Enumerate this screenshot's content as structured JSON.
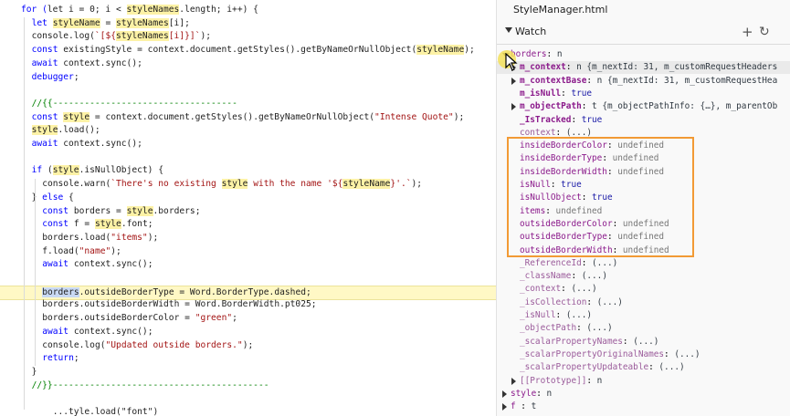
{
  "editor": {
    "lines": [
      {
        "indent": 0,
        "segs": [
          {
            "t": "for (",
            "c": "kw"
          },
          {
            "t": "let i = 0; i < "
          },
          {
            "t": "styleNames",
            "c": "hl"
          },
          {
            "t": ".length; i++) {"
          }
        ]
      },
      {
        "indent": 1,
        "segs": [
          {
            "t": "let ",
            "c": "kw"
          },
          {
            "t": "styleName",
            "c": "hl"
          },
          {
            "t": " = "
          },
          {
            "t": "styleNames",
            "c": "hl"
          },
          {
            "t": "[i];"
          }
        ]
      },
      {
        "indent": 1,
        "segs": [
          {
            "t": "console.log("
          },
          {
            "t": "`[${",
            "c": "str"
          },
          {
            "t": "styleNames",
            "c": "hl"
          },
          {
            "t": "[i]}]`",
            "c": "str"
          },
          {
            "t": ");"
          }
        ]
      },
      {
        "indent": 1,
        "segs": [
          {
            "t": "const ",
            "c": "kw"
          },
          {
            "t": "existingStyle = context.document.getStyles().getByNameOrNullObject("
          },
          {
            "t": "styleName",
            "c": "hl"
          },
          {
            "t": ");"
          }
        ]
      },
      {
        "indent": 1,
        "segs": [
          {
            "t": "await ",
            "c": "kw"
          },
          {
            "t": "context.sync();"
          }
        ]
      },
      {
        "indent": 1,
        "segs": [
          {
            "t": "debugger",
            "c": "kw"
          },
          {
            "t": ";"
          }
        ]
      },
      {
        "indent": 1,
        "segs": []
      },
      {
        "indent": 1,
        "segs": [
          {
            "t": "//{{-----------------------------------",
            "c": "cm"
          }
        ]
      },
      {
        "indent": 1,
        "segs": [
          {
            "t": "const ",
            "c": "kw"
          },
          {
            "t": "style",
            "c": "hl"
          },
          {
            "t": " = context.document.getStyles().getByNameOrNullObject("
          },
          {
            "t": "\"Intense Quote\"",
            "c": "str"
          },
          {
            "t": ");"
          }
        ]
      },
      {
        "indent": 1,
        "segs": [
          {
            "t": "style",
            "c": "hl"
          },
          {
            "t": ".load();"
          }
        ]
      },
      {
        "indent": 1,
        "segs": [
          {
            "t": "await ",
            "c": "kw"
          },
          {
            "t": "context.sync();"
          }
        ]
      },
      {
        "indent": 1,
        "segs": []
      },
      {
        "indent": 1,
        "segs": [
          {
            "t": "if ",
            "c": "kw"
          },
          {
            "t": "("
          },
          {
            "t": "style",
            "c": "hl"
          },
          {
            "t": ".isNullObject) {"
          }
        ]
      },
      {
        "indent": 2,
        "segs": [
          {
            "t": "console.warn("
          },
          {
            "t": "`There's no existing ",
            "c": "str"
          },
          {
            "t": "style",
            "c": "hl"
          },
          {
            "t": " with the name '${",
            "c": "str"
          },
          {
            "t": "styleName",
            "c": "hl"
          },
          {
            "t": "}'.`",
            "c": "str"
          },
          {
            "t": ");"
          }
        ]
      },
      {
        "indent": 1,
        "segs": [
          {
            "t": "} "
          },
          {
            "t": "else ",
            "c": "kw"
          },
          {
            "t": "{"
          }
        ]
      },
      {
        "indent": 2,
        "segs": [
          {
            "t": "const ",
            "c": "kw"
          },
          {
            "t": "borders = "
          },
          {
            "t": "style",
            "c": "hl"
          },
          {
            "t": ".borders;"
          }
        ]
      },
      {
        "indent": 2,
        "segs": [
          {
            "t": "const ",
            "c": "kw"
          },
          {
            "t": "f = "
          },
          {
            "t": "style",
            "c": "hl"
          },
          {
            "t": ".font;"
          }
        ]
      },
      {
        "indent": 2,
        "segs": [
          {
            "t": "borders.load("
          },
          {
            "t": "\"items\"",
            "c": "str"
          },
          {
            "t": ");"
          }
        ]
      },
      {
        "indent": 2,
        "segs": [
          {
            "t": "f.load("
          },
          {
            "t": "\"name\"",
            "c": "str"
          },
          {
            "t": ");"
          }
        ]
      },
      {
        "indent": 2,
        "segs": [
          {
            "t": "await ",
            "c": "kw"
          },
          {
            "t": "context.sync();"
          }
        ]
      },
      {
        "indent": 2,
        "segs": []
      },
      {
        "indent": 2,
        "current": true,
        "segs": [
          {
            "t": "borders",
            "c": "sel"
          },
          {
            "t": ".outsideBorderType = Word.BorderType.dashed;"
          }
        ]
      },
      {
        "indent": 2,
        "segs": [
          {
            "t": "borders.outsideBorderWidth = Word.BorderWidth.pt025;"
          }
        ]
      },
      {
        "indent": 2,
        "segs": [
          {
            "t": "borders.outsideBorderColor = "
          },
          {
            "t": "\"green\"",
            "c": "str"
          },
          {
            "t": ";"
          }
        ]
      },
      {
        "indent": 2,
        "segs": [
          {
            "t": "await ",
            "c": "kw"
          },
          {
            "t": "context.sync();"
          }
        ]
      },
      {
        "indent": 2,
        "segs": [
          {
            "t": "console.log("
          },
          {
            "t": "\"Updated outside borders.\"",
            "c": "str"
          },
          {
            "t": ");"
          }
        ]
      },
      {
        "indent": 2,
        "segs": [
          {
            "t": "return",
            "c": "kw"
          },
          {
            "t": ";"
          }
        ]
      },
      {
        "indent": 1,
        "segs": [
          {
            "t": "}"
          }
        ]
      },
      {
        "indent": 1,
        "segs": [
          {
            "t": "//}}-----------------------------------------",
            "c": "cm"
          }
        ]
      },
      {
        "indent": 1,
        "segs": []
      },
      {
        "indent": 1,
        "segs": [
          {
            "t": "    ...tyle.load(\"font\")"
          }
        ]
      }
    ]
  },
  "debugger": {
    "file_title": "StyleManager.html",
    "watch_label": "Watch",
    "add_icon": "plus-icon",
    "refresh_icon": "refresh-icon",
    "rows": [
      {
        "level": 0,
        "arrow": "down",
        "key": "borders",
        "sep": ": ",
        "val": "n",
        "kcls": "",
        "vcls": ""
      },
      {
        "level": 1,
        "arrow": "right",
        "key": "m_context",
        "sep": ": ",
        "val": "n {m_nextId: 31, m_customRequestHeaders",
        "kcls": "bold",
        "vcls": "",
        "hover": true
      },
      {
        "level": 1,
        "arrow": "right",
        "key": "m_contextBase",
        "sep": ": ",
        "val": "n {m_nextId: 31, m_customRequestHea",
        "kcls": "bold",
        "vcls": ""
      },
      {
        "level": 1,
        "arrow": "",
        "key": "m_isNull",
        "sep": ": ",
        "val": "true",
        "kcls": "bold",
        "vcls": "num"
      },
      {
        "level": 1,
        "arrow": "right",
        "key": "m_objectPath",
        "sep": ": ",
        "val": "t {m_objectPathInfo: {…}, m_parentOb",
        "kcls": "bold",
        "vcls": ""
      },
      {
        "level": 1,
        "arrow": "",
        "key": "_IsTracked",
        "sep": ": ",
        "val": "true",
        "kcls": "bold",
        "vcls": "num"
      },
      {
        "level": 1,
        "arrow": "",
        "key": "context",
        "sep": ": ",
        "val": "(...)",
        "kcls": "dim",
        "vcls": ""
      },
      {
        "level": 1,
        "arrow": "",
        "key": "insideBorderColor",
        "sep": ": ",
        "val": "undefined",
        "kcls": "",
        "vcls": "dim"
      },
      {
        "level": 1,
        "arrow": "",
        "key": "insideBorderType",
        "sep": ": ",
        "val": "undefined",
        "kcls": "",
        "vcls": "dim"
      },
      {
        "level": 1,
        "arrow": "",
        "key": "insideBorderWidth",
        "sep": ": ",
        "val": "undefined",
        "kcls": "",
        "vcls": "dim"
      },
      {
        "level": 1,
        "arrow": "",
        "key": "isNull",
        "sep": ": ",
        "val": "true",
        "kcls": "",
        "vcls": "num"
      },
      {
        "level": 1,
        "arrow": "",
        "key": "isNullObject",
        "sep": ": ",
        "val": "true",
        "kcls": "",
        "vcls": "num"
      },
      {
        "level": 1,
        "arrow": "",
        "key": "items",
        "sep": ": ",
        "val": "undefined",
        "kcls": "",
        "vcls": "dim"
      },
      {
        "level": 1,
        "arrow": "",
        "key": "outsideBorderColor",
        "sep": ": ",
        "val": "undefined",
        "kcls": "",
        "vcls": "dim"
      },
      {
        "level": 1,
        "arrow": "",
        "key": "outsideBorderType",
        "sep": ": ",
        "val": "undefined",
        "kcls": "",
        "vcls": "dim"
      },
      {
        "level": 1,
        "arrow": "",
        "key": "outsideBorderWidth",
        "sep": ": ",
        "val": "undefined",
        "kcls": "",
        "vcls": "dim"
      },
      {
        "level": 1,
        "arrow": "",
        "key": "_ReferenceId",
        "sep": ": ",
        "val": "(...)",
        "kcls": "dim",
        "vcls": ""
      },
      {
        "level": 1,
        "arrow": "",
        "key": "_className",
        "sep": ": ",
        "val": "(...)",
        "kcls": "dim",
        "vcls": ""
      },
      {
        "level": 1,
        "arrow": "",
        "key": "_context",
        "sep": ": ",
        "val": "(...)",
        "kcls": "dim",
        "vcls": ""
      },
      {
        "level": 1,
        "arrow": "",
        "key": "_isCollection",
        "sep": ": ",
        "val": "(...)",
        "kcls": "dim",
        "vcls": ""
      },
      {
        "level": 1,
        "arrow": "",
        "key": "_isNull",
        "sep": ": ",
        "val": "(...)",
        "kcls": "dim",
        "vcls": ""
      },
      {
        "level": 1,
        "arrow": "",
        "key": "_objectPath",
        "sep": ": ",
        "val": "(...)",
        "kcls": "dim",
        "vcls": ""
      },
      {
        "level": 1,
        "arrow": "",
        "key": "_scalarPropertyNames",
        "sep": ": ",
        "val": "(...)",
        "kcls": "dim",
        "vcls": ""
      },
      {
        "level": 1,
        "arrow": "",
        "key": "_scalarPropertyOriginalNames",
        "sep": ": ",
        "val": "(...)",
        "kcls": "dim",
        "vcls": ""
      },
      {
        "level": 1,
        "arrow": "",
        "key": "_scalarPropertyUpdateable",
        "sep": ": ",
        "val": "(...)",
        "kcls": "dim",
        "vcls": ""
      },
      {
        "level": 1,
        "arrow": "right",
        "key": "[[Prototype]]",
        "sep": ": ",
        "val": "n",
        "kcls": "dim",
        "vcls": ""
      },
      {
        "level": 0,
        "arrow": "right",
        "key": "style",
        "sep": ": ",
        "val": "n",
        "kcls": "",
        "vcls": ""
      },
      {
        "level": 0,
        "arrow": "right",
        "key": "f",
        "sep": "  : ",
        "val": "t",
        "kcls": "",
        "vcls": ""
      }
    ]
  }
}
